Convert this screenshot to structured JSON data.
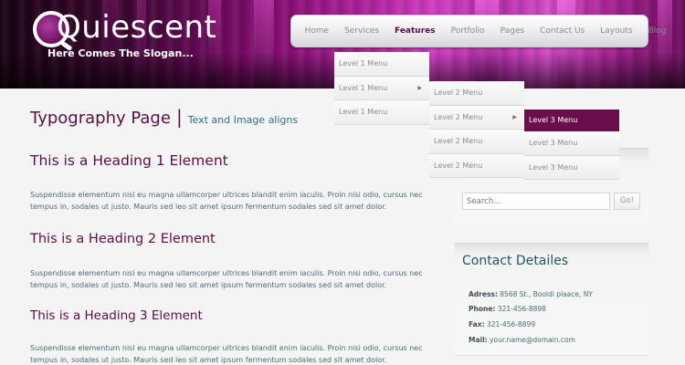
{
  "brand": {
    "logo": "Quiescent",
    "slogan": "Here Comes The Slogan..."
  },
  "nav": [
    "Home",
    "Services",
    "Features",
    "Portfolio",
    "Pages",
    "Contact Us",
    "Layouts",
    "Blog"
  ],
  "nav_active": "Features",
  "menus": {
    "level1": [
      "Level 1 Menu",
      "Level 1 Menu",
      "Level 1 Menu"
    ],
    "level2": [
      "Level 2 Menu",
      "Level 2 Menu",
      "Level 2 Menu",
      "Level 2 Menu"
    ],
    "level3": [
      "Level 3 Menu",
      "Level 3 Menu",
      "Level 3 Menu"
    ]
  },
  "page": {
    "title": "Typography Page",
    "separator": "|",
    "subtitle": "Text and Image aligns",
    "h1": "This is a Heading 1 Element",
    "h2": "This is a Heading 2 Element",
    "h3": "This is a Heading 3 Element",
    "para": "Suspendisse elementum nisl eu magna ullamcorper ultrices blandit enim iaculis. Proin nisi odio, cursus nec tempus in, sodales ut justo. Mauris sed leo sit amet ipsum fermentum sodales sed sit amet dolor."
  },
  "search": {
    "placeholder": "Search...",
    "button": "Go!"
  },
  "contact": {
    "title": "Contact Detailes",
    "address_label": "Adress:",
    "address": "8568 St., Booldi plaace, NY",
    "phone_label": "Phone:",
    "phone": "321-456-8898",
    "fax_label": "Fax:",
    "fax": "321-456-8899",
    "mail_label": "Mail:",
    "mail": "your.name@domain.com"
  },
  "colors": {
    "accent": "#5a0f44",
    "highlight": "#6a0e4c",
    "link": "#2d6f80"
  }
}
